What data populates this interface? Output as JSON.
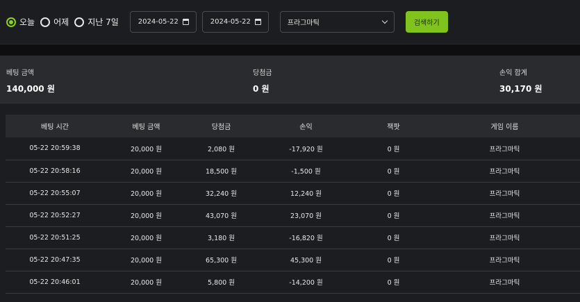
{
  "filters": {
    "radios": [
      {
        "label": "오늘",
        "checked": true
      },
      {
        "label": "어제",
        "checked": false
      },
      {
        "label": "지난 7일",
        "checked": false
      }
    ],
    "date_from": "2024-05-22",
    "date_to": "2024-05-22",
    "game_select": "프라그마틱",
    "search_label": "검색하기"
  },
  "summary": {
    "bet_label": "베팅 금액",
    "bet_value": "140,000 원",
    "win_label": "당첨금",
    "win_value": "0 원",
    "profit_label": "손익 합계",
    "profit_value": "30,170 원"
  },
  "table": {
    "headers": [
      "베팅 시간",
      "베팅 금액",
      "당첨금",
      "손익",
      "잭팟",
      "게임 이름"
    ],
    "rows": [
      [
        "05-22 20:59:38",
        "20,000 원",
        "2,080 원",
        "-17,920 원",
        "0 원",
        "프라그마틱"
      ],
      [
        "05-22 20:58:16",
        "20,000 원",
        "18,500 원",
        "-1,500 원",
        "0 원",
        "프라그마틱"
      ],
      [
        "05-22 20:55:07",
        "20,000 원",
        "32,240 원",
        "12,240 원",
        "0 원",
        "프라그마틱"
      ],
      [
        "05-22 20:52:27",
        "20,000 원",
        "43,070 원",
        "23,070 원",
        "0 원",
        "프라그마틱"
      ],
      [
        "05-22 20:51:25",
        "20,000 원",
        "3,180 원",
        "-16,820 원",
        "0 원",
        "프라그마틱"
      ],
      [
        "05-22 20:47:35",
        "20,000 원",
        "65,300 원",
        "45,300 원",
        "0 원",
        "프라그마틱"
      ],
      [
        "05-22 20:46:01",
        "20,000 원",
        "5,800 원",
        "-14,200 원",
        "0 원",
        "프라그마틱"
      ]
    ]
  },
  "colors": {
    "accent": "#8ad11f",
    "button": "#7fc31c",
    "background": "#1c1d20",
    "panel": "#2a2b2f"
  }
}
